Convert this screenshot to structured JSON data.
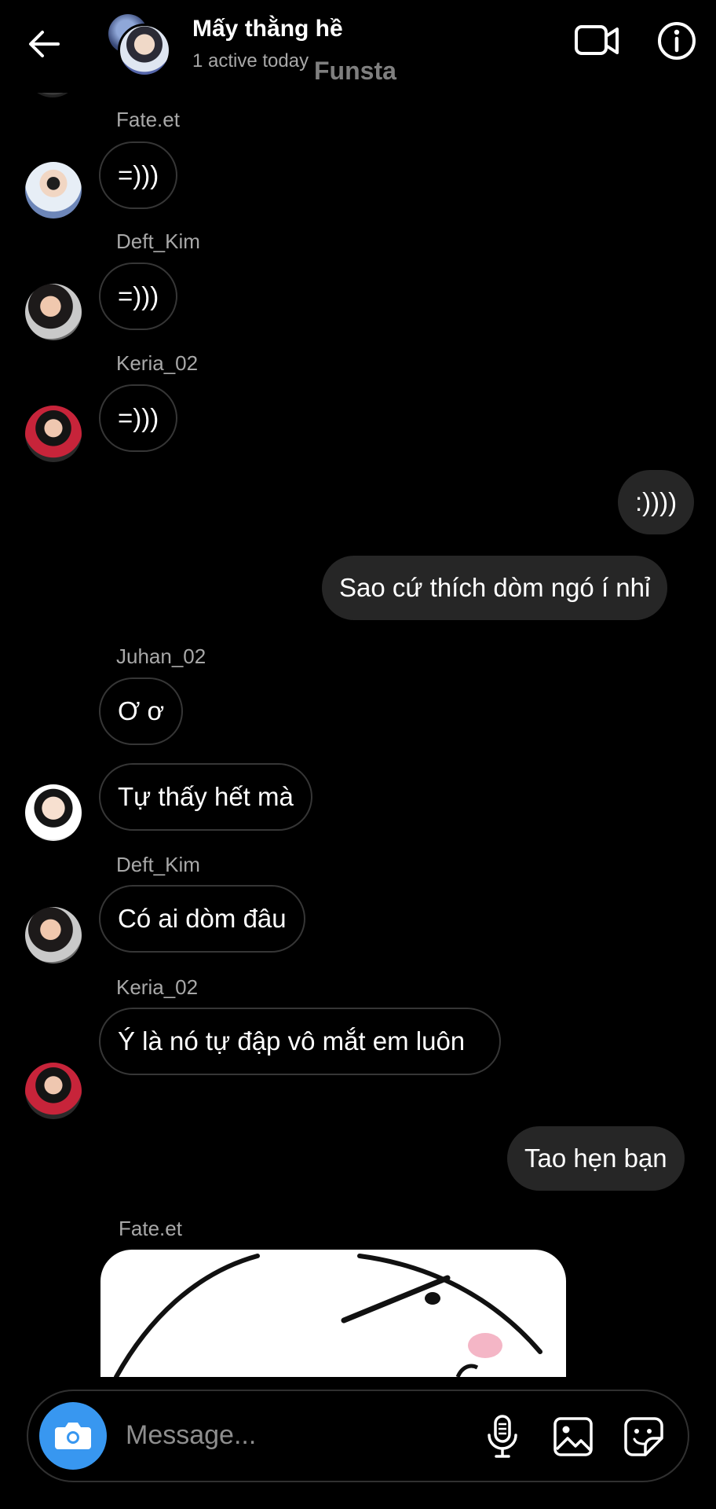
{
  "header": {
    "title": "Mấy thằng hề",
    "subtitle": "1 active today",
    "watermark": "Funsta",
    "icons": [
      "back-arrow-icon",
      "video-call-icon",
      "info-icon"
    ]
  },
  "messages": [
    {
      "sender": "Fate.et",
      "text": "=)))"
    },
    {
      "sender": "Deft_Kim",
      "text": "=)))"
    },
    {
      "sender": "Keria_02",
      "text": "=)))"
    },
    {
      "outgoing": true,
      "text": ":))))"
    },
    {
      "outgoing": true,
      "text": "Sao cứ thích dòm ngó í nhỉ"
    },
    {
      "sender": "Juhan_02",
      "text": "Ơ ơ"
    },
    {
      "sender": "Juhan_02",
      "text": "Tự thấy hết mà"
    },
    {
      "sender": "Deft_Kim",
      "text": "Có ai dòm đâu"
    },
    {
      "sender": "Keria_02",
      "text": "Ý là nó tự đập vô mắt em luôn"
    },
    {
      "outgoing": true,
      "text": "Tao hẹn bạn"
    },
    {
      "sender": "Fate.et",
      "type": "image",
      "image_desc": "sticker-drawing"
    }
  ],
  "composer": {
    "placeholder": "Message...",
    "icons": [
      "camera-icon",
      "microphone-icon",
      "gallery-icon",
      "sticker-icon"
    ],
    "camera_color": "#3897f0"
  },
  "colors": {
    "background": "#000000",
    "outgoing_bubble": "#262626",
    "incoming_border": "#363636",
    "secondary_text": "#a8a8a8"
  }
}
